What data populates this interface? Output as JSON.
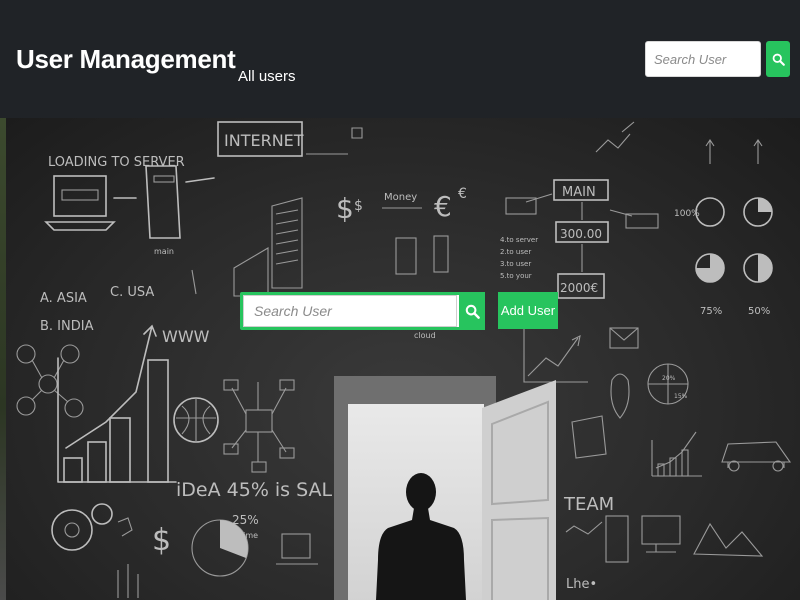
{
  "header": {
    "brand": "User Management",
    "nav_link": "All users",
    "search": {
      "placeholder": "Search User",
      "button_icon": "search-icon"
    }
  },
  "hero": {
    "search": {
      "placeholder": "Search User",
      "button_icon": "search-icon"
    },
    "add_user_label": "Add User",
    "chalk_text": {
      "loading": "LOADING TO SERVER",
      "internet": "INTERNET",
      "money": "Money",
      "main": "MAIN",
      "main_value": "300.00",
      "year_value": "2000€",
      "asia": "A. ASIA",
      "usa": "C. USA",
      "india": "B. INDIA",
      "www": "WWW",
      "idea": "iDeA 45% is SALE!",
      "pct_100": "100%",
      "pct_75": "75%",
      "pct_50": "50%",
      "team": "TEAM",
      "cloud": "cloud",
      "pct_25": "25%",
      "time": "time"
    }
  },
  "colors": {
    "accent": "#27c45e",
    "header_bg": "#202327",
    "text": "#ffffff"
  }
}
